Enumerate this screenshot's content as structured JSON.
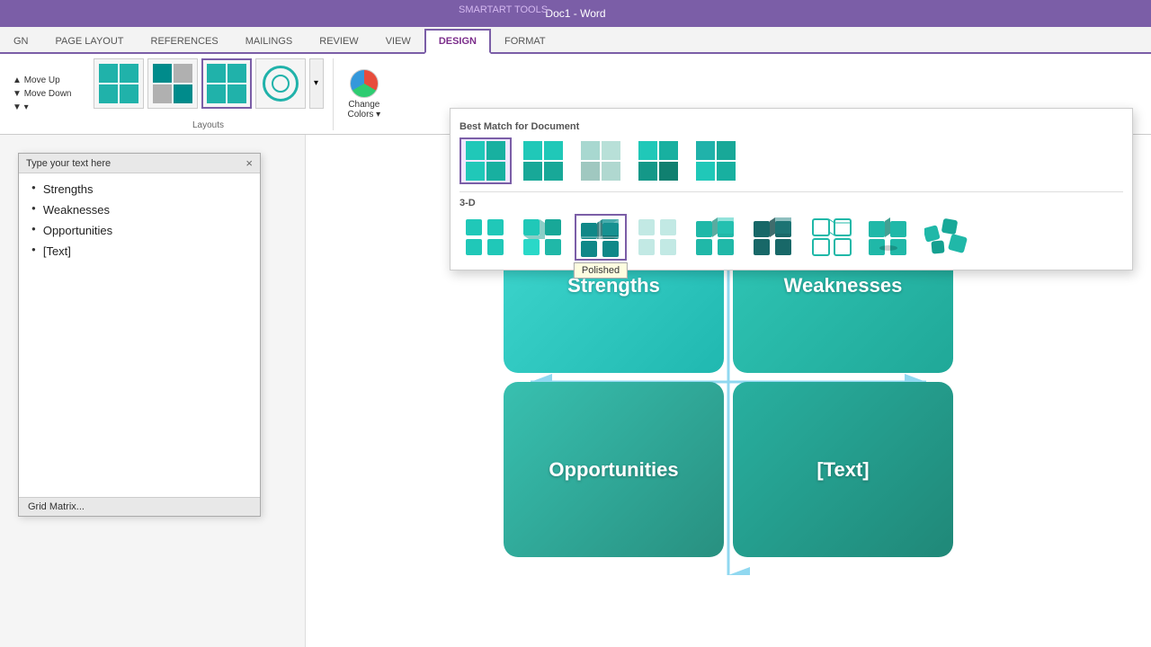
{
  "titleBar": {
    "docTitle": "Doc1 - Word",
    "smartartTools": "SMARTART TOOLS"
  },
  "ribbonTabs": {
    "tabs": [
      {
        "id": "sign",
        "label": "GN",
        "active": false
      },
      {
        "id": "page-layout",
        "label": "PAGE LAYOUT",
        "active": false
      },
      {
        "id": "references",
        "label": "REFERENCES",
        "active": false
      },
      {
        "id": "mailings",
        "label": "MAILINGS",
        "active": false
      },
      {
        "id": "review",
        "label": "REVIEW",
        "active": false
      },
      {
        "id": "view",
        "label": "VIEW",
        "active": false
      },
      {
        "id": "design",
        "label": "DESIGN",
        "active": true
      },
      {
        "id": "format",
        "label": "FORMAT",
        "active": false
      }
    ]
  },
  "ribbon": {
    "moveUp": "Move Up",
    "moveDown": "Move Down",
    "layoutLabel": "Layouts",
    "changeColors": "Change\nColors",
    "dropdownArrow": "▾"
  },
  "dropdown": {
    "bestMatchLabel": "Best Match for Document",
    "threeDLabel": "3-D",
    "polishedTooltip": "Polished",
    "colorOptions": [
      {
        "id": "opt1",
        "selected": true,
        "colors": [
          "#1abc9c",
          "#16a085",
          "#1abc9c",
          "#16a085"
        ]
      },
      {
        "id": "opt2",
        "selected": false,
        "colors": [
          "#1abc9c",
          "#1abc9c",
          "#16a085",
          "#16a085"
        ]
      },
      {
        "id": "opt3",
        "selected": false,
        "colors": [
          "#a8d8d8",
          "#b0e0e0",
          "#a0c8c8",
          "#b8d8d8"
        ]
      },
      {
        "id": "opt4",
        "selected": false,
        "colors": [
          "#1abc9c",
          "#16a085",
          "#14967a",
          "#12806a"
        ]
      },
      {
        "id": "opt5",
        "selected": false,
        "colors": [
          "#20b2aa",
          "#17a899",
          "#1abc9c",
          "#16a085"
        ]
      }
    ],
    "threeDOptions": [
      {
        "id": "3d1",
        "label": "flat-teal"
      },
      {
        "id": "3d2",
        "label": "gradient-teal"
      },
      {
        "id": "3d3",
        "label": "dark-teal",
        "selected": true
      },
      {
        "id": "3d4",
        "label": "light-3d"
      },
      {
        "id": "3d5",
        "label": "medium-3d"
      },
      {
        "id": "3d6",
        "label": "dark-3d"
      },
      {
        "id": "3d7",
        "label": "outline-3d"
      },
      {
        "id": "3d8",
        "label": "shadow-3d"
      },
      {
        "id": "3d9",
        "label": "perspective-3d"
      }
    ]
  },
  "textEditor": {
    "title": "Type your text here",
    "closeLabel": "×",
    "bullets": [
      {
        "text": "Strengths"
      },
      {
        "text": "Weaknesses"
      },
      {
        "text": "Opportunities"
      },
      {
        "text": "[Text]"
      }
    ],
    "footerText": "Grid Matrix..."
  },
  "swot": {
    "strengths": "Strengths",
    "weaknesses": "Weaknesses",
    "opportunities": "Opportunities",
    "text": "[Text]"
  }
}
